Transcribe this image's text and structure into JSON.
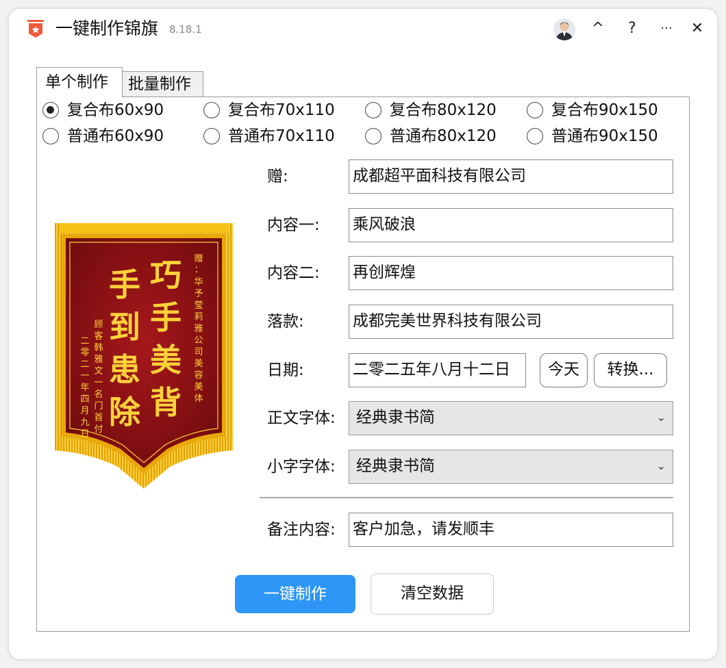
{
  "app": {
    "title": "一键制作锦旗",
    "version": "8.18.1",
    "buttons": {
      "collapse": "^",
      "help": "?",
      "more": "···",
      "close": "✕"
    }
  },
  "tabs": [
    {
      "label": "单个制作",
      "active": true
    },
    {
      "label": "批量制作",
      "active": false
    }
  ],
  "sizes": {
    "composite": [
      "复合布60x90",
      "复合布70x110",
      "复合布80x120",
      "复合布90x150"
    ],
    "plain": [
      "普通布60x90",
      "普通布70x110",
      "普通布80x120",
      "普通布90x150"
    ],
    "selected": "复合布60x90"
  },
  "form": {
    "to_label": "赠:",
    "to_value": "成都超平面科技有限公司",
    "content1_label": "内容一:",
    "content1_value": "乘风破浪",
    "content2_label": "内容二:",
    "content2_value": "再创辉煌",
    "sign_label": "落款:",
    "sign_value": "成都完美世界科技有限公司",
    "date_label": "日期:",
    "date_value": "二零二五年八月十二日",
    "today_button": "今天",
    "convert_button": "转换...",
    "body_font_label": "正文字体:",
    "body_font_value": "经典隶书简",
    "small_font_label": "小字字体:",
    "small_font_value": "经典隶书简",
    "note_label": "备注内容:",
    "note_value": "客户加急，请发顺丰"
  },
  "actions": {
    "make": "一键制作",
    "clear": "清空数据"
  },
  "preview": {
    "main_right": "巧手美背",
    "main_left": "手到患除",
    "recipient": "赠：华予莹莉雅公司美容美体",
    "giver": "顾客韩雅文一名门首付",
    "date": "二零二一年四月九日"
  },
  "colors": {
    "accent": "#2d96f6",
    "banner_red": "#8e0f12",
    "fringe_gold": "#f2b80f",
    "text_gold": "#ffd23a",
    "logo_orange": "#ef5a3c"
  }
}
